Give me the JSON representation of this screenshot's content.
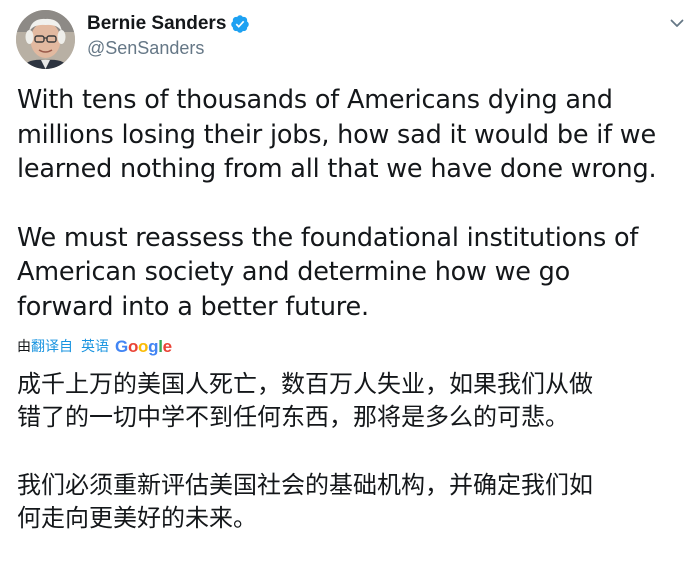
{
  "author": {
    "display_name": "Bernie Sanders",
    "handle": "@SenSanders",
    "verified_icon": "verified-badge-icon",
    "avatar": "avatar-photo"
  },
  "tweet": {
    "paragraphs": [
      "With tens of thousands of Americans dying and\nmillions losing their jobs, how sad it would be if we\nlearned nothing from all that we have done wrong.",
      "We must reassess the foundational institutions of\nAmerican society and determine how we go\nforward into a better future."
    ]
  },
  "translation": {
    "prefix": "由",
    "link_label": "翻译自",
    "language": "英语",
    "provider_letters": [
      "G",
      "o",
      "o",
      "g",
      "l",
      "e"
    ],
    "paragraphs": [
      "成千上万的美国人死亡，数百万人失业，如果我们从做\n错了的一切中学不到任何东西，那将是多么的可悲。",
      "我们必须重新评估美国社会的基础机构，并确定我们如\n何走向更美好的未来。"
    ]
  },
  "menu": {
    "icon": "chevron-down-icon"
  },
  "colors": {
    "link": "#1b95e0",
    "text": "#14171a",
    "secondary": "#657786",
    "verified": "#1da1f2"
  }
}
